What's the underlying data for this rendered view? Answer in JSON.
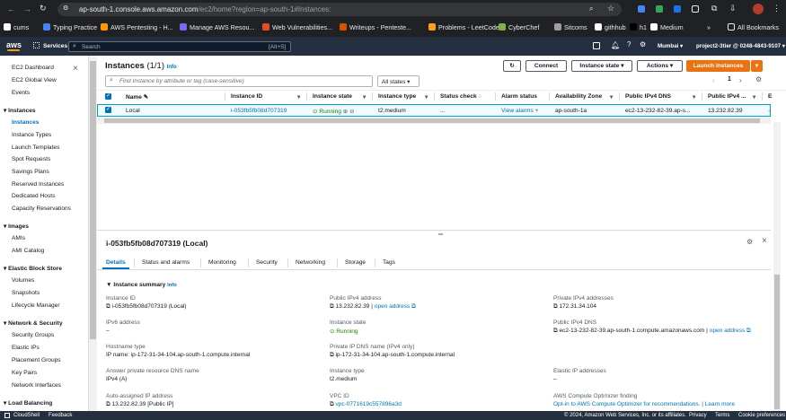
{
  "browser": {
    "url_host": "ap-south-1.console.aws.amazon.com",
    "url_path": "/ec2/home?region=ap-south-1#Instances:",
    "bookmarks": [
      {
        "label": "cums",
        "color": "#ffffff"
      },
      {
        "label": "Typing Practice",
        "color": "#4285f4"
      },
      {
        "label": "AWS Pentesting - H...",
        "color": "#ff9900"
      },
      {
        "label": "Manage AWS Resou...",
        "color": "#7b68ee"
      },
      {
        "label": "Web Vulnerabilities...",
        "color": "#e44d26"
      },
      {
        "label": "Writeups - Penteste...",
        "color": "#d35400"
      },
      {
        "label": "Problems - LeetCode",
        "color": "#ffa116"
      },
      {
        "label": "CyberChef",
        "color": "#7cb342"
      },
      {
        "label": "Sitcoms",
        "color": "#9e9e9e"
      },
      {
        "label": "githhub",
        "color": "#ffffff"
      },
      {
        "label": "h1",
        "color": "#000000"
      },
      {
        "label": "Medium",
        "color": "#ffffff"
      }
    ],
    "more": "»",
    "all_bookmarks": "All Bookmarks"
  },
  "aws": {
    "logo": "aws",
    "services": "Services",
    "search_placeholder": "Search",
    "search_shortcut": "[Alt+S]",
    "region": "Mumbai",
    "account": "project2-3tier @ 0248-4843-9107"
  },
  "sidebar": {
    "items": [
      {
        "label": "EC2 Dashboard",
        "type": "item"
      },
      {
        "label": "EC2 Global View",
        "type": "item"
      },
      {
        "label": "Events",
        "type": "item"
      },
      {
        "label": "Instances",
        "type": "header"
      },
      {
        "label": "Instances",
        "type": "active"
      },
      {
        "label": "Instance Types",
        "type": "item"
      },
      {
        "label": "Launch Templates",
        "type": "item"
      },
      {
        "label": "Spot Requests",
        "type": "item"
      },
      {
        "label": "Savings Plans",
        "type": "item"
      },
      {
        "label": "Reserved Instances",
        "type": "item"
      },
      {
        "label": "Dedicated Hosts",
        "type": "item"
      },
      {
        "label": "Capacity Reservations",
        "type": "item"
      },
      {
        "label": "Images",
        "type": "header"
      },
      {
        "label": "AMIs",
        "type": "item"
      },
      {
        "label": "AMI Catalog",
        "type": "item"
      },
      {
        "label": "Elastic Block Store",
        "type": "header"
      },
      {
        "label": "Volumes",
        "type": "item"
      },
      {
        "label": "Snapshots",
        "type": "item"
      },
      {
        "label": "Lifecycle Manager",
        "type": "item"
      },
      {
        "label": "Network & Security",
        "type": "header"
      },
      {
        "label": "Security Groups",
        "type": "item"
      },
      {
        "label": "Elastic IPs",
        "type": "item"
      },
      {
        "label": "Placement Groups",
        "type": "item"
      },
      {
        "label": "Key Pairs",
        "type": "item"
      },
      {
        "label": "Network Interfaces",
        "type": "item"
      },
      {
        "label": "Load Balancing",
        "type": "header"
      }
    ]
  },
  "instances": {
    "title": "Instances",
    "count": "(1/1)",
    "info": "Info",
    "connect": "Connect",
    "instance_state": "Instance state",
    "actions": "Actions",
    "launch": "Launch instances",
    "filter_placeholder": "Find Instance by attribute or tag (case-sensitive)",
    "states_filter": "All states",
    "page": "1",
    "columns": [
      "Name",
      "Instance ID",
      "Instance state",
      "Instance type",
      "Status check",
      "Alarm status",
      "Availability Zone",
      "Public IPv4 DNS",
      "Public IPv4 ...",
      "E"
    ],
    "row": {
      "name": "Local",
      "id": "i-053fb5fb08d707319",
      "state": "Running",
      "type": "t2.medium",
      "status_check": "...",
      "alarm": "View alarms",
      "az": "ap-south-1a",
      "dns": "ec2-13-232-82-39.ap-s...",
      "ip": "13.232.82.39",
      "extra": "-"
    }
  },
  "details": {
    "title": "i-053fb5fb08d707319 (Local)",
    "tabs": [
      "Details",
      "Status and alarms",
      "Monitoring",
      "Security",
      "Networking",
      "Storage",
      "Tags"
    ],
    "summary": "Instance summary",
    "summary_info": "Info",
    "fields": [
      {
        "label": "Instance ID",
        "value": "i-053fb5fb08d707319 (Local)",
        "copy": true
      },
      {
        "label": "Public IPv4 address",
        "value": "13.232.82.39 |",
        "link": "open address",
        "copy": true
      },
      {
        "label": "Private IPv4 addresses",
        "value": "172.31.34.104",
        "copy": true
      },
      {
        "label": "IPv6 address",
        "value": "–"
      },
      {
        "label": "Instance state",
        "value": "Running",
        "status": true
      },
      {
        "label": "Public IPv4 DNS",
        "value": "ec2-13-232-82-39.ap-south-1.compute.amazonaws.com |",
        "link": "open address",
        "copy": true
      },
      {
        "label": "Hostname type",
        "value": "IP name: ip-172-31-34-104.ap-south-1.compute.internal"
      },
      {
        "label": "Private IP DNS name (IPv4 only)",
        "value": "ip-172-31-34-104.ap-south-1.compute.internal",
        "copy": true
      },
      {
        "label": "",
        "value": ""
      },
      {
        "label": "Answer private resource DNS name",
        "value": "IPv4 (A)"
      },
      {
        "label": "Instance type",
        "value": "t2.medium"
      },
      {
        "label": "Elastic IP addresses",
        "value": "–"
      },
      {
        "label": "Auto-assigned IP address",
        "value": "13.232.82.39 [Public IP]",
        "copy": true
      },
      {
        "label": "VPC ID",
        "value": "vpc-0771619c557896a3d",
        "copy": true,
        "linkval": true
      },
      {
        "label": "AWS Compute Optimizer finding",
        "value": "Opt-in to AWS Compute Optimizer for recommendations. | Learn more",
        "linkval": true
      }
    ]
  },
  "footer": {
    "cloudshell": "CloudShell",
    "feedback": "Feedback",
    "copyright": "© 2024, Amazon Web Services, Inc. or its affiliates.",
    "privacy": "Privacy",
    "terms": "Terms",
    "cookie": "Cookie preferences"
  }
}
